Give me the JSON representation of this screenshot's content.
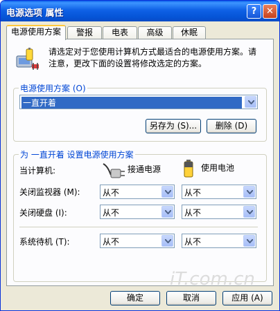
{
  "window": {
    "title": "电源选项 属性",
    "help_glyph": "?",
    "close_glyph": "✕"
  },
  "tabs": [
    {
      "label": "电源使用方案",
      "active": true
    },
    {
      "label": "警报"
    },
    {
      "label": "电表"
    },
    {
      "label": "高级"
    },
    {
      "label": "休眠"
    }
  ],
  "intro": {
    "text": "请选定对于您使用计算机方式最适合的电源使用方案。请注意，更改下面的设置将修改选定的方案。"
  },
  "scheme_group": {
    "label": "电源使用方案 (O)",
    "selected_value": "一直开着",
    "save_as_label": "另存为 (S)...",
    "delete_label": "删除 (D)"
  },
  "settings_group": {
    "label": "为 一直开着 设置电源使用方案",
    "row_header": "当计算机:",
    "col_ac": "接通电源",
    "col_battery": "使用电池",
    "rows": [
      {
        "label": "关闭监视器 (M):",
        "ac": "从不",
        "battery": "从不"
      },
      {
        "label": "关闭硬盘 (I):",
        "ac": "从不",
        "battery": "从不"
      },
      {
        "label": "系统待机 (T):",
        "ac": "从不",
        "battery": "从不"
      }
    ]
  },
  "footer": {
    "ok_label": "确定",
    "cancel_label": "取消",
    "apply_label": "应用 (A)"
  },
  "watermark": "iT.com.cn"
}
